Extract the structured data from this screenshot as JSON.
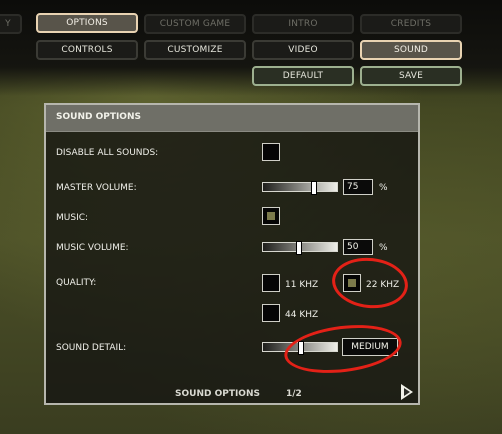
{
  "topnav": {
    "left_partial": "Y",
    "row1": [
      "OPTIONS",
      "CUSTOM GAME",
      "INTRO",
      "CREDITS"
    ],
    "row2": [
      "CONTROLS",
      "CUSTOMIZE",
      "VIDEO",
      "SOUND"
    ],
    "row3": [
      "DEFAULT",
      "SAVE"
    ]
  },
  "panel": {
    "title": "SOUND OPTIONS",
    "rows": {
      "disable_all": "DISABLE ALL SOUNDS:",
      "master_volume": "MASTER VOLUME:",
      "music": "MUSIC:",
      "music_volume": "MUSIC VOLUME:",
      "quality": "QUALITY:",
      "sound_detail": "SOUND DETAIL:"
    },
    "values": {
      "master_volume": "75",
      "music_volume": "50",
      "percent": "%",
      "quality_11": "11 KHZ",
      "quality_22": "22 KHZ",
      "quality_44": "44 KHZ",
      "sound_detail": "MEDIUM"
    },
    "states": {
      "disable_all_checked": false,
      "music_checked": true,
      "quality_selected": "22 KHZ"
    }
  },
  "footer": {
    "title": "SOUND OPTIONS",
    "page": "1/2"
  },
  "colors": {
    "accent_active": "#e9d3b2",
    "annotation_red": "#e32117",
    "checkbox_fill": "#7b7a4b"
  },
  "icons": {
    "next": "right-arrow-icon"
  }
}
